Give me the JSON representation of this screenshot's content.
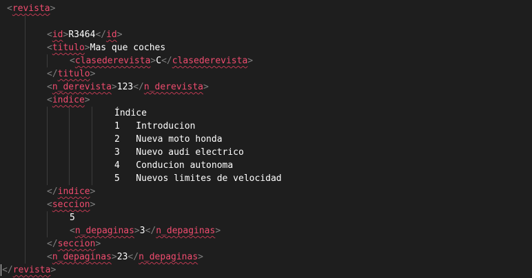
{
  "lines": [
    {
      "open": "revista"
    },
    {},
    {
      "open": "id",
      "text": "R3464",
      "close": "id"
    },
    {
      "open": "titulo",
      "text": "Mas que coches"
    },
    {
      "open": "clasederevista",
      "text": "C",
      "close": "clasederevista"
    },
    {
      "close": "titulo"
    },
    {
      "open": "n_derevista",
      "text": "123",
      "close": "n_derevista"
    },
    {
      "open": "indice"
    },
    {
      "text": "Índice"
    },
    {
      "text": "1   Introducion"
    },
    {
      "text": "2   Nueva moto honda"
    },
    {
      "text": "3   Nuevo audi electrico"
    },
    {
      "text": "4   Conducion autonoma"
    },
    {
      "text": "5   Nuevos limites de velocidad"
    },
    {
      "close": "indice"
    },
    {
      "open": "seccion"
    },
    {
      "text": "5"
    },
    {
      "open": "n_depaginas",
      "text": "3",
      "close": "n_depaginas"
    },
    {
      "close": "seccion"
    },
    {
      "open": "n_depaginas",
      "text": "23",
      "close": "n_depaginas"
    },
    {
      "close": "revista"
    }
  ],
  "colors": {
    "background": "#1e1e1e",
    "tag": "#f14c6f",
    "bracket": "#808080",
    "text": "#ffffff",
    "indent_guide": "#3d3d3d"
  }
}
